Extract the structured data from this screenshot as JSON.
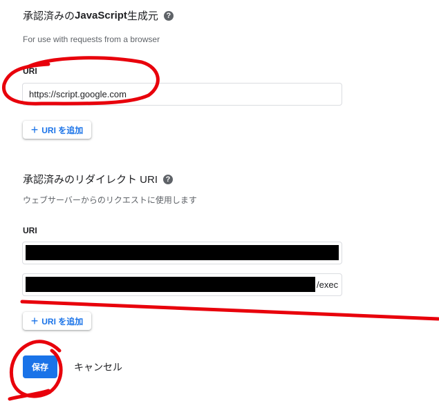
{
  "js_origins": {
    "title_prefix": "承認済みの ",
    "title_bold": "JavaScript",
    "title_suffix": " 生成元",
    "help_glyph": "?",
    "description": "For use with requests from a browser",
    "uri_label": "URI",
    "uris": [
      "https://script.google.com"
    ],
    "add_button_label": "URI を追加",
    "add_icon": "plus-icon"
  },
  "redirect_uris": {
    "title": "承認済みのリダイレクト URI",
    "help_glyph": "?",
    "description": "ウェブサーバーからのリクエストに使用します",
    "uri_label": "URI",
    "uris": [
      "",
      "/exec"
    ],
    "add_button_label": "URI を追加",
    "add_icon": "plus-icon"
  },
  "actions": {
    "save_label": "保存",
    "cancel_label": "キャンセル"
  },
  "colors": {
    "accent": "#1a73e8",
    "annotation": "#e8000b",
    "redaction": "#000000"
  }
}
